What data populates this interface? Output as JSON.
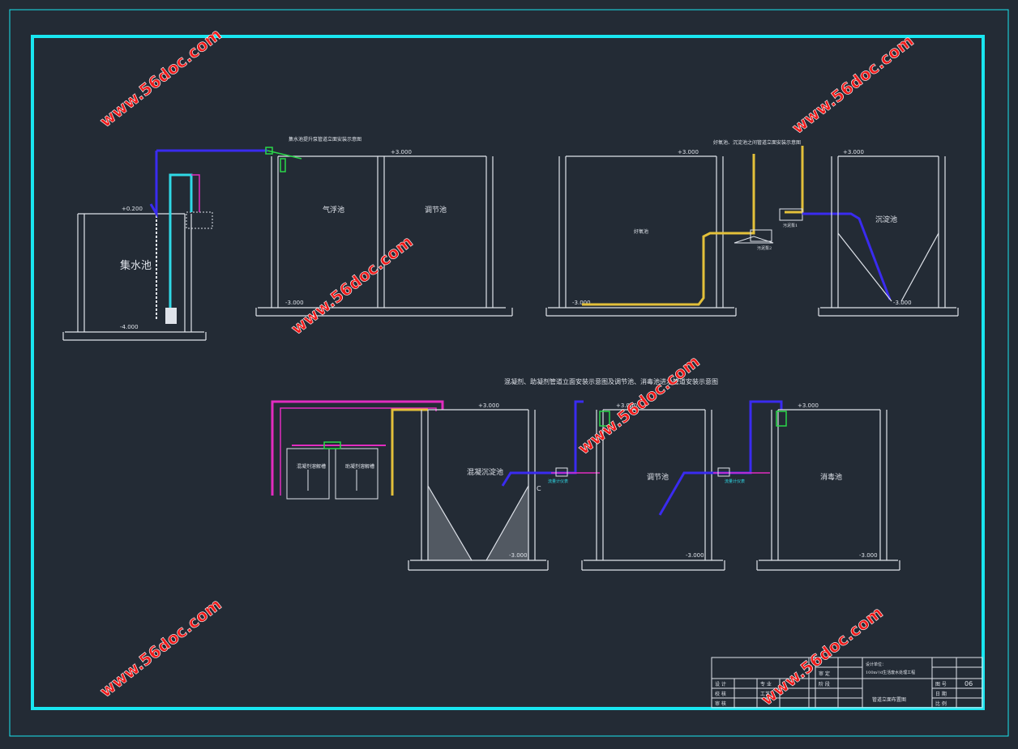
{
  "drawing": {
    "watermark": "www.56doc.com",
    "colors": {
      "background": "#232b35",
      "frame_cyan": "#19e6f0",
      "white_line": "#dfe3ea",
      "pipe_blue": "#3a2bf0",
      "pipe_yellow": "#e3c03a",
      "pipe_magenta": "#e22cc0",
      "pipe_cyan": "#2fd9e6",
      "pipe_green": "#2bd84a",
      "watermark_red": "#f01a1a"
    },
    "tanks": {
      "collection": "集水池",
      "air_flotation": "气浮池",
      "regulating_top": "调节池",
      "hydrolysis": "好氧池",
      "settling_top": "沉淀池",
      "coag_settling": "混凝沉淀池",
      "regulating_bottom": "调节池",
      "disinfection": "消毒池"
    },
    "labels": {
      "top_left_title": "集水池提升泵管道立面安装示意图",
      "top_right_title": "好氧池、沉淀池之间管道立面安装示意图",
      "bottom_title": "混凝剂、助凝剂管道立面安装示意图及调节池、消毒池进水管道安装示意图",
      "dosing_tank_1": "混凝剂溶解槽",
      "dosing_tank_2": "助凝剂溶解槽",
      "elev_pos_3": "+3.000",
      "elev_pos_0_2": "+0.200",
      "elev_neg_3": "-3.000",
      "elev_neg_4": "-4.000",
      "pump_label_1": "污泥泵1",
      "pump_label_2": "污泥泵2",
      "flowmeter_label": "流量计仪表",
      "mark_c": "C"
    },
    "title_block": {
      "row1": [
        "设 计",
        "",
        "",
        "工程名称",
        "",
        "校 对",
        "",
        "设计证号"
      ],
      "project_name": "100m³/d生活废水处理工程",
      "drawing_name": "管道立面布置图",
      "designer_label": "设计单位：",
      "sheet_label": "图 号",
      "sheet_no": "06",
      "approve": "审 定",
      "check": "审 核",
      "scale": "比 例",
      "date": "日 期",
      "author": "设 计",
      "discipline": "专 业",
      "ratio": "工艺",
      "stage": "阶 段",
      "review": "校 核"
    }
  }
}
